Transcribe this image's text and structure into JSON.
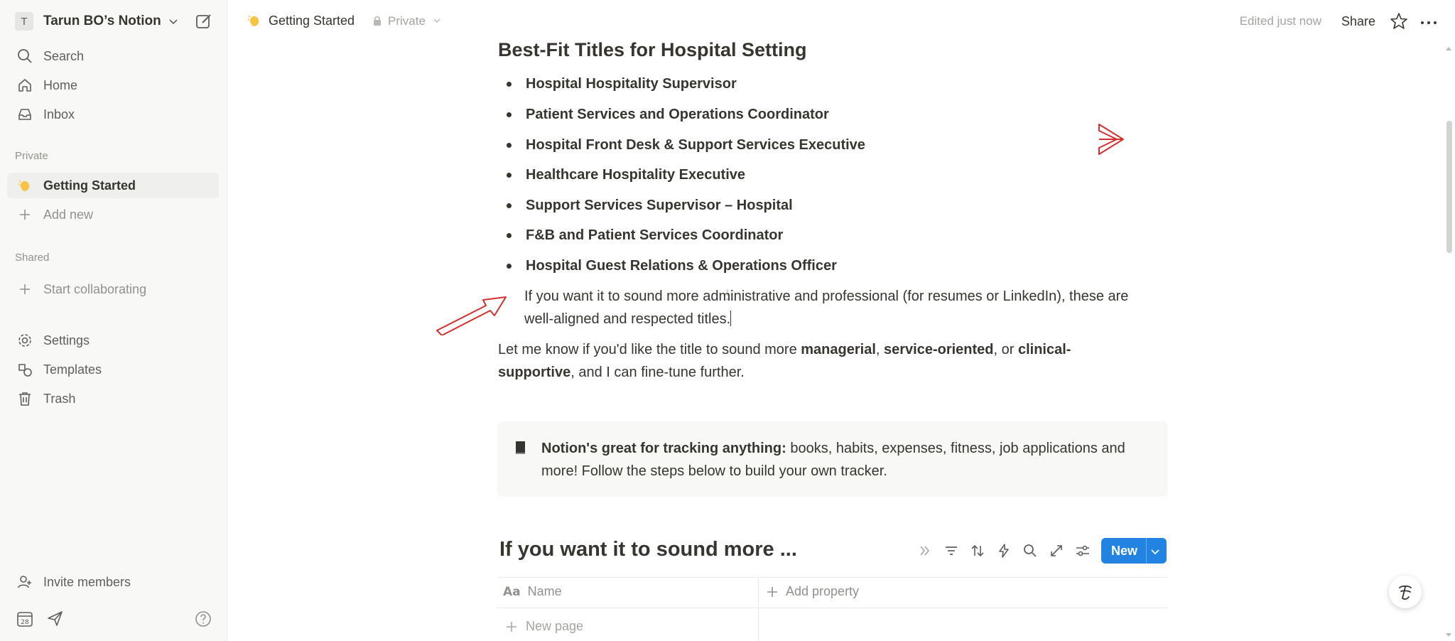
{
  "sidebar": {
    "workspace": {
      "avatar": "T",
      "name": "Tarun BO’s Notion"
    },
    "nav": [
      {
        "label": "Search",
        "icon": "search-icon"
      },
      {
        "label": "Home",
        "icon": "home-icon"
      },
      {
        "label": "Inbox",
        "icon": "inbox-icon"
      }
    ],
    "private_label": "Private",
    "private_items": [
      {
        "label": "Getting Started",
        "icon": "wave-hand-icon"
      },
      {
        "label": "Add new",
        "icon": "plus-icon"
      }
    ],
    "shared_label": "Shared",
    "shared_items": [
      {
        "label": "Start collaborating",
        "icon": "plus-icon"
      }
    ],
    "utility": [
      {
        "label": "Settings",
        "icon": "gear-icon"
      },
      {
        "label": "Templates",
        "icon": "templates-icon"
      },
      {
        "label": "Trash",
        "icon": "trash-icon"
      }
    ],
    "invite_label": "Invite members",
    "calendar_day": "28"
  },
  "topbar": {
    "page_title": "Getting Started",
    "privacy": "Private",
    "edited": "Edited just now",
    "share": "Share"
  },
  "content": {
    "heading": "Best-Fit Titles for Hospital Setting",
    "bullets": [
      "Hospital Hospitality Supervisor",
      "Patient Services and Operations Coordinator",
      "Hospital Front Desk & Support Services Executive",
      "Healthcare Hospitality Executive",
      "Support Services Supervisor – Hospital",
      "F&B and Patient Services Coordinator",
      "Hospital Guest Relations & Operations Officer"
    ],
    "para1_line1": "If you want it to sound more administrative and professional (for resumes or LinkedIn), these are",
    "para1_line2": "well-aligned and respected titles.",
    "para2": {
      "t1": "Let me know if you'd like the title to sound more ",
      "b1": "managerial",
      "t2": ", ",
      "b2": "service-oriented",
      "t3": ", or ",
      "b3": "clinical-",
      "b4": "supportive",
      "t4": ", and I can fine-tune further."
    },
    "callout": {
      "bold": "Notion's great for tracking anything:",
      "rest1": " books, habits, expenses, fitness, job applications and",
      "rest2": "more! Follow the steps below to build your own tracker."
    },
    "database": {
      "title": "If you want it to sound more ...",
      "new_label": "New",
      "col_name_prefix": "Aa",
      "col_name": "Name",
      "add_property": "Add property",
      "new_page": "New page"
    }
  },
  "colors": {
    "accent": "#2383e2",
    "annotation": "#d32f2f",
    "sidebar_bg": "#f8f8f7"
  }
}
